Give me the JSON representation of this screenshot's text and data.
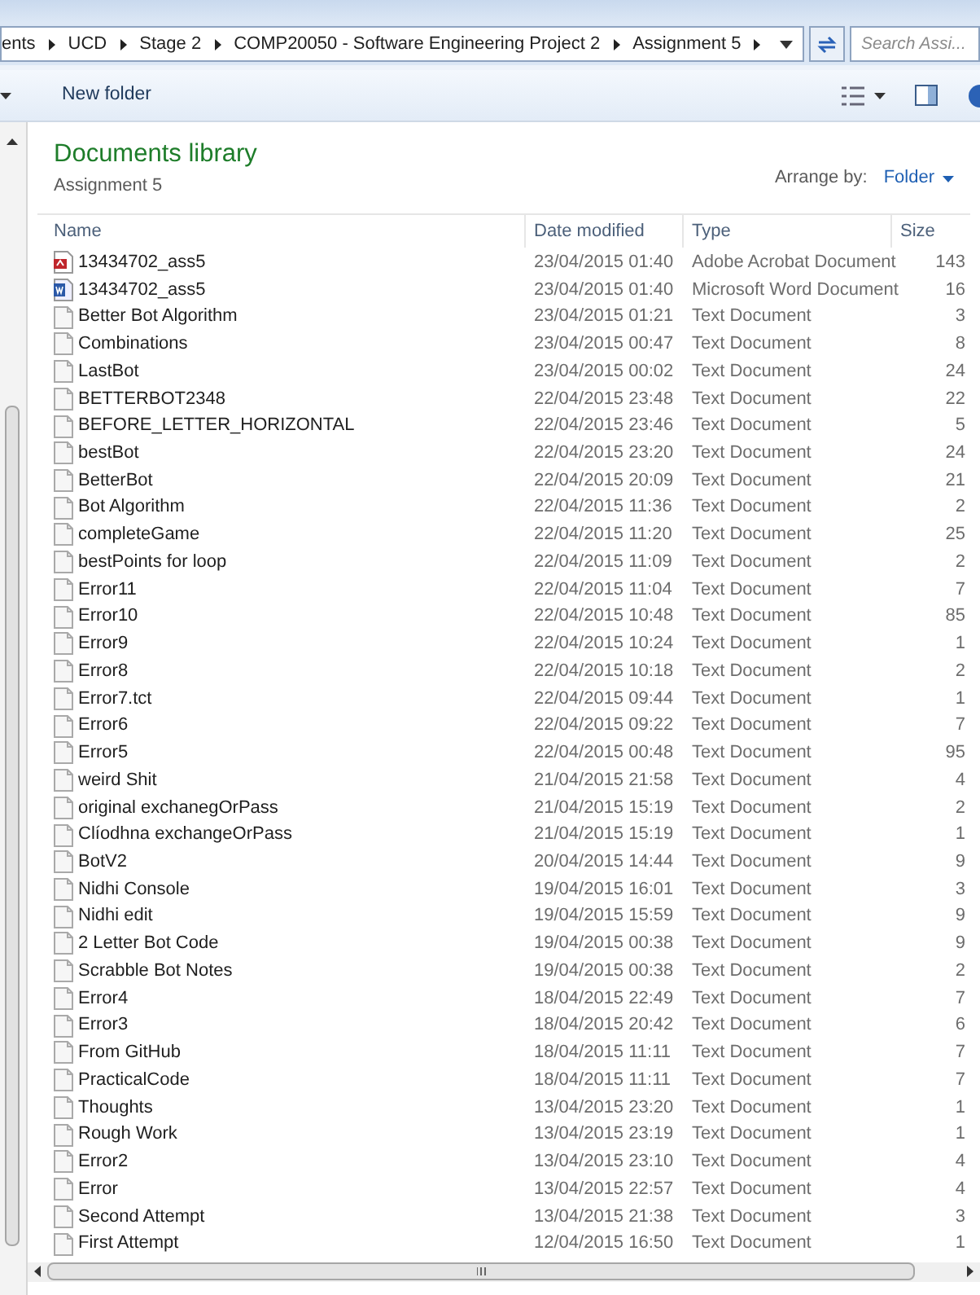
{
  "breadcrumb": [
    "ents",
    "UCD",
    "Stage 2",
    "COMP20050 - Software Engineering Project 2",
    "Assignment 5"
  ],
  "search": {
    "placeholder": "Search Assi..."
  },
  "toolbar": {
    "new_folder": "New folder"
  },
  "library": {
    "title": "Documents library",
    "subtitle": "Assignment 5",
    "arrange_label": "Arrange by:",
    "arrange_value": "Folder"
  },
  "columns": [
    "Name",
    "Date modified",
    "Type",
    "Size"
  ],
  "rows": [
    {
      "kind": "pdf",
      "name": "13434702_ass5",
      "date": "23/04/2015 01:40",
      "type": "Adobe Acrobat Document",
      "size": "143"
    },
    {
      "kind": "word",
      "name": "13434702_ass5",
      "date": "23/04/2015 01:40",
      "type": "Microsoft Word Document",
      "size": "16"
    },
    {
      "kind": "text",
      "name": "Better Bot Algorithm",
      "date": "23/04/2015 01:21",
      "type": "Text Document",
      "size": "3"
    },
    {
      "kind": "text",
      "name": "Combinations",
      "date": "23/04/2015 00:47",
      "type": "Text Document",
      "size": "8"
    },
    {
      "kind": "text",
      "name": "LastBot",
      "date": "23/04/2015 00:02",
      "type": "Text Document",
      "size": "24"
    },
    {
      "kind": "text",
      "name": "BETTERBOT2348",
      "date": "22/04/2015 23:48",
      "type": "Text Document",
      "size": "22"
    },
    {
      "kind": "text",
      "name": "BEFORE_LETTER_HORIZONTAL",
      "date": "22/04/2015 23:46",
      "type": "Text Document",
      "size": "5"
    },
    {
      "kind": "text",
      "name": "bestBot",
      "date": "22/04/2015 23:20",
      "type": "Text Document",
      "size": "24"
    },
    {
      "kind": "text",
      "name": "BetterBot",
      "date": "22/04/2015 20:09",
      "type": "Text Document",
      "size": "21"
    },
    {
      "kind": "text",
      "name": "Bot Algorithm",
      "date": "22/04/2015 11:36",
      "type": "Text Document",
      "size": "2"
    },
    {
      "kind": "text",
      "name": "completeGame",
      "date": "22/04/2015 11:20",
      "type": "Text Document",
      "size": "25"
    },
    {
      "kind": "text",
      "name": "bestPoints for loop",
      "date": "22/04/2015 11:09",
      "type": "Text Document",
      "size": "2"
    },
    {
      "kind": "text",
      "name": "Error11",
      "date": "22/04/2015 11:04",
      "type": "Text Document",
      "size": "7"
    },
    {
      "kind": "text",
      "name": "Error10",
      "date": "22/04/2015 10:48",
      "type": "Text Document",
      "size": "85"
    },
    {
      "kind": "text",
      "name": "Error9",
      "date": "22/04/2015 10:24",
      "type": "Text Document",
      "size": "1"
    },
    {
      "kind": "text",
      "name": "Error8",
      "date": "22/04/2015 10:18",
      "type": "Text Document",
      "size": "2"
    },
    {
      "kind": "text",
      "name": "Error7.tct",
      "date": "22/04/2015 09:44",
      "type": "Text Document",
      "size": "1"
    },
    {
      "kind": "text",
      "name": "Error6",
      "date": "22/04/2015 09:22",
      "type": "Text Document",
      "size": "7"
    },
    {
      "kind": "text",
      "name": "Error5",
      "date": "22/04/2015 00:48",
      "type": "Text Document",
      "size": "95"
    },
    {
      "kind": "text",
      "name": "weird Shit",
      "date": "21/04/2015 21:58",
      "type": "Text Document",
      "size": "4"
    },
    {
      "kind": "text",
      "name": "original exchanegOrPass",
      "date": "21/04/2015 15:19",
      "type": "Text Document",
      "size": "2"
    },
    {
      "kind": "text",
      "name": "Clíodhna exchangeOrPass",
      "date": "21/04/2015 15:19",
      "type": "Text Document",
      "size": "1"
    },
    {
      "kind": "text",
      "name": "BotV2",
      "date": "20/04/2015 14:44",
      "type": "Text Document",
      "size": "9"
    },
    {
      "kind": "text",
      "name": "Nidhi Console",
      "date": "19/04/2015 16:01",
      "type": "Text Document",
      "size": "3"
    },
    {
      "kind": "text",
      "name": "Nidhi edit",
      "date": "19/04/2015 15:59",
      "type": "Text Document",
      "size": "9"
    },
    {
      "kind": "text",
      "name": "2 Letter Bot Code",
      "date": "19/04/2015 00:38",
      "type": "Text Document",
      "size": "9"
    },
    {
      "kind": "text",
      "name": "Scrabble Bot Notes",
      "date": "19/04/2015 00:38",
      "type": "Text Document",
      "size": "2"
    },
    {
      "kind": "text",
      "name": "Error4",
      "date": "18/04/2015 22:49",
      "type": "Text Document",
      "size": "7"
    },
    {
      "kind": "text",
      "name": "Error3",
      "date": "18/04/2015 20:42",
      "type": "Text Document",
      "size": "6"
    },
    {
      "kind": "text",
      "name": "From GitHub",
      "date": "18/04/2015 11:11",
      "type": "Text Document",
      "size": "7"
    },
    {
      "kind": "text",
      "name": "PracticalCode",
      "date": "18/04/2015 11:11",
      "type": "Text Document",
      "size": "7"
    },
    {
      "kind": "text",
      "name": "Thoughts",
      "date": "13/04/2015 23:20",
      "type": "Text Document",
      "size": "1"
    },
    {
      "kind": "text",
      "name": "Rough Work",
      "date": "13/04/2015 23:19",
      "type": "Text Document",
      "size": "1"
    },
    {
      "kind": "text",
      "name": "Error2",
      "date": "13/04/2015 23:10",
      "type": "Text Document",
      "size": "4"
    },
    {
      "kind": "text",
      "name": "Error",
      "date": "13/04/2015 22:57",
      "type": "Text Document",
      "size": "4"
    },
    {
      "kind": "text",
      "name": "Second Attempt",
      "date": "13/04/2015 21:38",
      "type": "Text Document",
      "size": "3"
    },
    {
      "kind": "text",
      "name": "First Attempt",
      "date": "12/04/2015 16:50",
      "type": "Text Document",
      "size": "1"
    }
  ]
}
